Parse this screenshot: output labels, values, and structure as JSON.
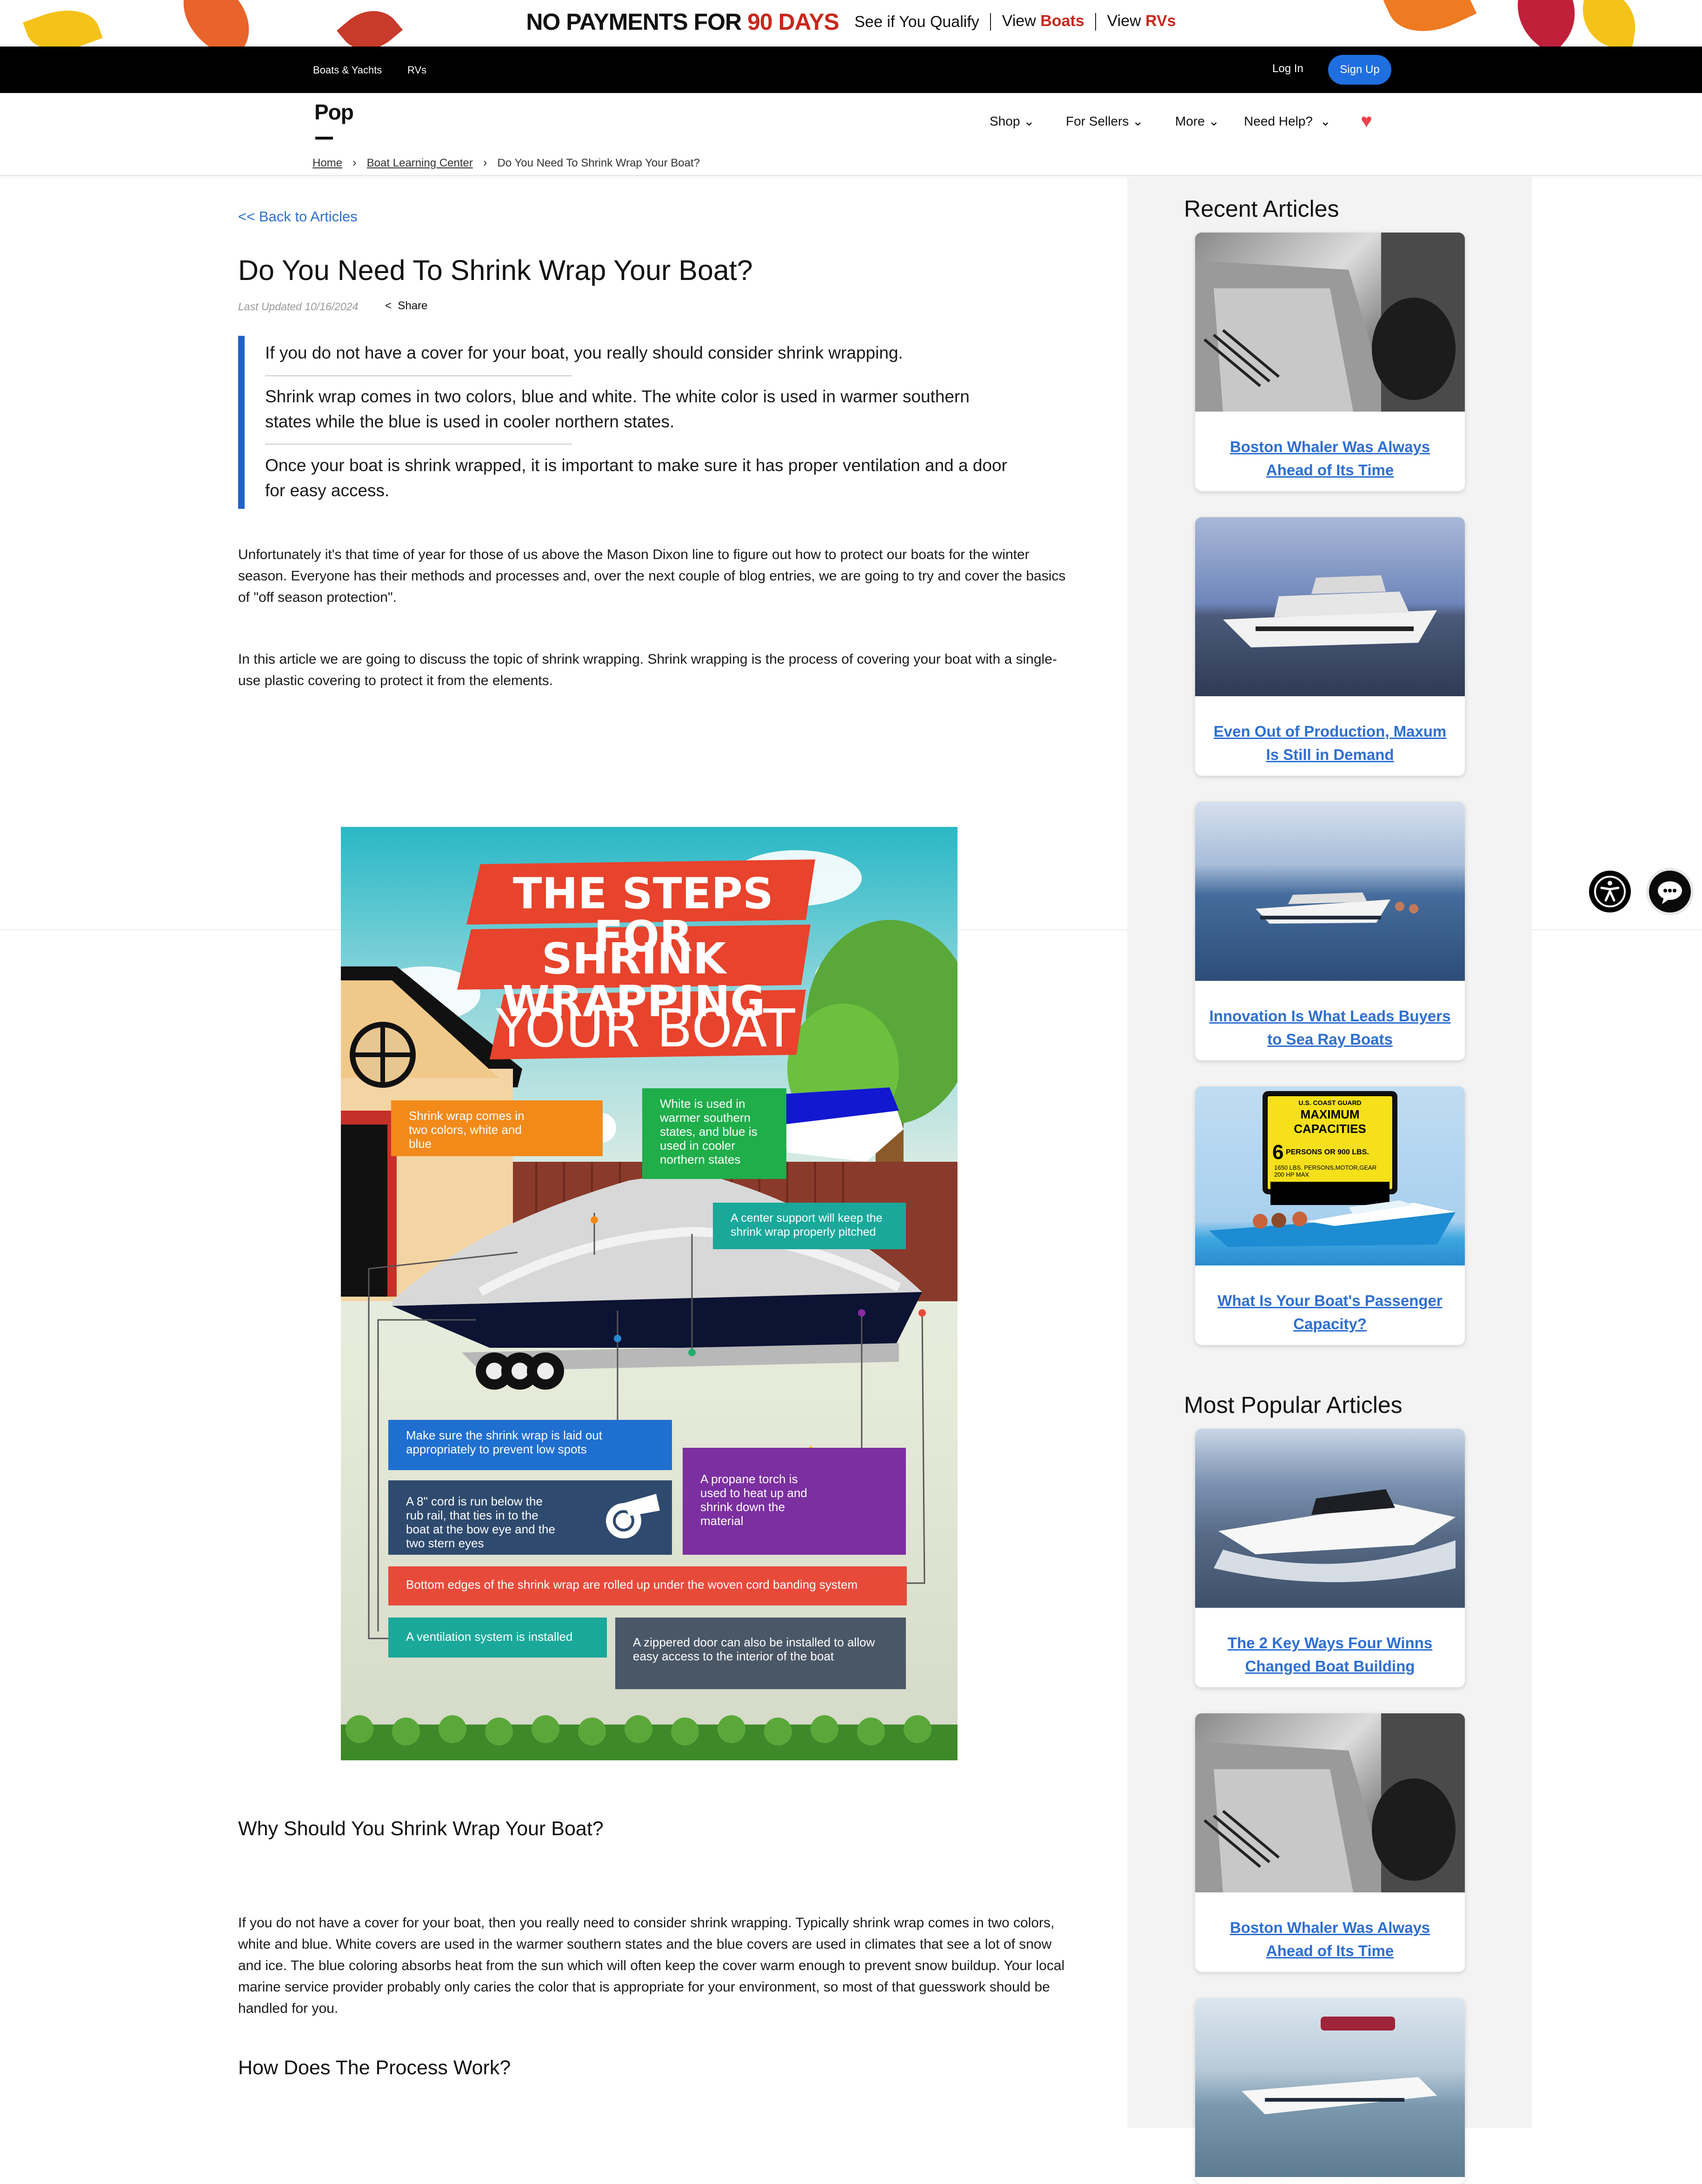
{
  "promo": {
    "headline_a": "NO PAYMENTS FOR",
    "headline_b": "90 DAYS",
    "qualify": "See if You Qualify",
    "view_boats_a": "View",
    "view_boats_b": "Boats",
    "view_rvs_a": "View",
    "view_rvs_b": "RVs"
  },
  "topbar": {
    "links": [
      "Boats & Yachts",
      "RVs"
    ],
    "login": "Log In",
    "signup": "Sign Up"
  },
  "nav": {
    "logo": "Pop",
    "menu": [
      "Shop",
      "For Sellers",
      "More",
      "Need Help?"
    ]
  },
  "breadcrumb": [
    "Home",
    "Boat Learning Center",
    "Do You Need To Shrink Wrap Your Boat?"
  ],
  "article": {
    "back": "<< Back to Articles",
    "title": "Do You Need To Shrink Wrap Your Boat?",
    "updated": "Last Updated 10/16/2024",
    "share": "Share",
    "highlights": [
      "If you do not have a cover for your boat, you really should consider shrink wrapping.",
      "Shrink wrap comes in two colors, blue and white. The white color is used in warmer southern states while the blue is used in cooler northern states.",
      "Once your boat is shrink wrapped, it is important to make sure it has proper ventilation and a door for easy access."
    ],
    "para1": "Unfortunately it's that time of year for those of us above the Mason Dixon line to figure out how to protect our boats for the winter season. Everyone has their methods and processes and, over the next couple of blog entries, we are going to try and cover the basics of \"off season protection\".",
    "para2": "In this article we are going to discuss the topic of shrink wrapping. Shrink wrapping is the process of covering your boat with a single-use plastic covering to protect it from the elements.",
    "h2_why": "Why Should You Shrink Wrap Your Boat?",
    "para3": "If you do not have a cover for your boat, then you really need to consider shrink wrapping. Typically shrink wrap comes in two colors, white and blue. White covers are used in the warmer southern states and the blue covers are used in climates that see a lot of snow and ice. The blue coloring absorbs heat from the sun which will often keep the cover warm enough to prevent snow buildup. Your local marine service provider probably only caries the color that is appropriate for your environment, so most of that guesswork should be handled for you.",
    "h2_how": "How Does The Process Work?"
  },
  "infographic": {
    "banner1": "THE STEPS FOR",
    "banner2": "SHRINK WRAPPING",
    "banner3": "YOUR BOAT",
    "box_colors": "Shrink wrap comes in two colors, white and blue",
    "box_climate": "White is used in warmer southern states, and blue is used in cooler northern states",
    "box_support": "A center support will keep the shrink wrap properly pitched",
    "box_laid": "Make sure the shrink wrap is laid out appropriately to prevent low spots",
    "box_torch": "A propane torch is used to heat up and shrink down the material",
    "box_cord": "A 8\" cord is run below the rub rail, that ties in to the boat at the bow eye and the two stern eyes",
    "box_edges": "Bottom edges of the shrink wrap are rolled up under the woven cord banding system",
    "box_vent": "A ventilation system is installed",
    "box_door": "A zippered door can also be installed to allow easy access to the interior of the boat"
  },
  "sidebar": {
    "recent_heading": "Recent Articles",
    "recent": [
      "Boston Whaler Was Always Ahead of Its Time",
      "Even Out of Production, Maxum Is Still in Demand",
      "Innovation Is What Leads Buyers to Sea Ray Boats",
      "What Is Your Boat's Passenger Capacity?"
    ],
    "popular_heading": "Most Popular Articles",
    "popular": [
      "The 2 Key Ways Four Winns Changed Boat Building",
      "Boston Whaler Was Always Ahead of Its Time"
    ],
    "capacity_sign": {
      "org": "U.S. COAST GUARD",
      "title": "MAXIMUM CAPACITIES",
      "persons": "6",
      "persons_text": "PERSONS OR 900 LBS.",
      "weight": "1650 LBS. PERSONS,MOTOR,GEAR",
      "hp": "200 HP MAX"
    }
  },
  "colors": {
    "accent": "#1f6fe0",
    "promo_red": "#c8281e",
    "link": "#2f6fd0",
    "heart": "#f0414a"
  }
}
